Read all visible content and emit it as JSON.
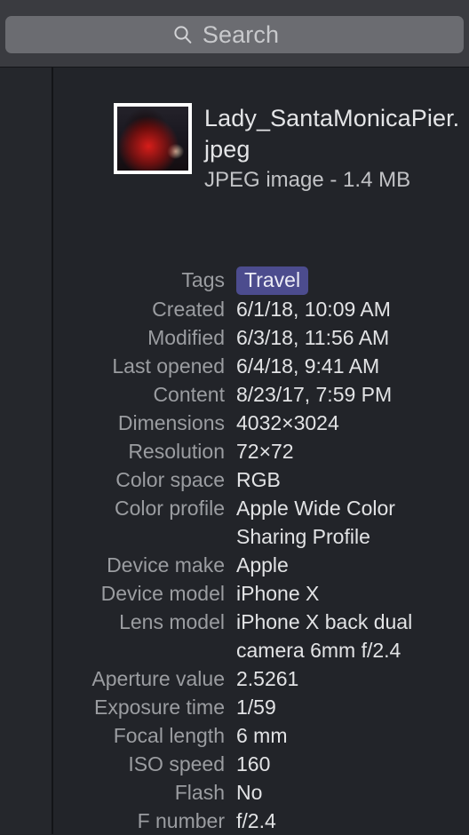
{
  "toolbar": {
    "search": {
      "placeholder": "Search",
      "value": "",
      "icon": "search-icon"
    }
  },
  "file": {
    "name": "Lady_SantaMonicaPier.jpeg",
    "kind_and_size": "JPEG image - 1.4 MB",
    "thumbnail_alt": "photo-thumbnail"
  },
  "metadata": {
    "rows": [
      {
        "label": "Tags",
        "value": "Travel",
        "type": "tag"
      },
      {
        "label": "Created",
        "value": "6/1/18, 10:09 AM",
        "type": "text"
      },
      {
        "label": "Modified",
        "value": "6/3/18, 11:56 AM",
        "type": "text"
      },
      {
        "label": "Last opened",
        "value": "6/4/18, 9:41 AM",
        "type": "text"
      },
      {
        "label": "Content",
        "value": "8/23/17, 7:59 PM",
        "type": "text"
      },
      {
        "label": "Dimensions",
        "value": "4032×3024",
        "type": "text"
      },
      {
        "label": "Resolution",
        "value": "72×72",
        "type": "text"
      },
      {
        "label": "Color space",
        "value": "RGB",
        "type": "text"
      },
      {
        "label": "Color profile",
        "value": "Apple Wide Color\nSharing Profile",
        "type": "text"
      },
      {
        "label": "Device make",
        "value": "Apple",
        "type": "text"
      },
      {
        "label": "Device model",
        "value": "iPhone X",
        "type": "text"
      },
      {
        "label": "Lens model",
        "value": "iPhone X back dual\ncamera 6mm f/2.4",
        "type": "text"
      },
      {
        "label": "Aperture value",
        "value": "2.5261",
        "type": "text"
      },
      {
        "label": "Exposure time",
        "value": "1/59",
        "type": "text"
      },
      {
        "label": "Focal length",
        "value": "6 mm",
        "type": "text"
      },
      {
        "label": "ISO speed",
        "value": "160",
        "type": "text"
      },
      {
        "label": "Flash",
        "value": "No",
        "type": "text"
      },
      {
        "label": "F number",
        "value": "f/2.4",
        "type": "text"
      }
    ]
  },
  "colors": {
    "toolbar_background": "#3a3b40",
    "search_field": "#6b6c71",
    "panel_background": "#222429",
    "sidebar_background": "#25272c",
    "divider": "#131417",
    "label_text": "#9b9da1",
    "value_text": "#e2e3e5",
    "tag_travel": "#4c4c8e"
  }
}
